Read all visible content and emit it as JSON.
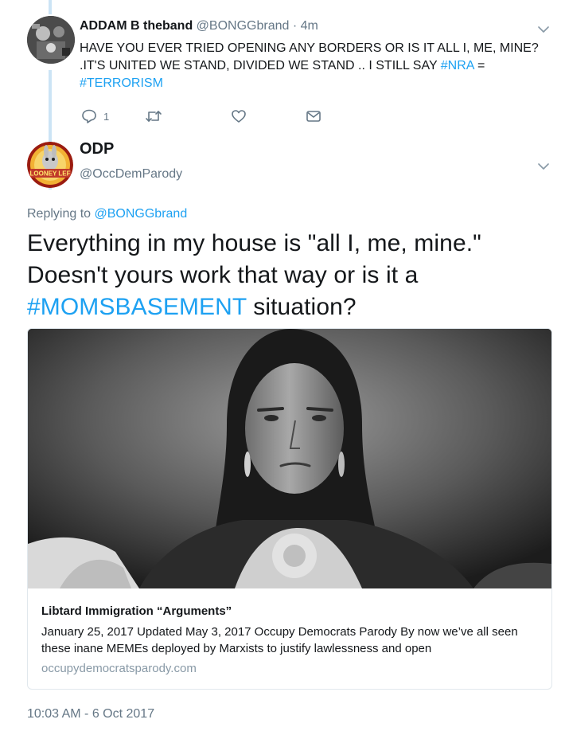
{
  "reply": {
    "author_name": "ADDAM B theband",
    "handle": "@BONGGbrand",
    "separator": "·",
    "time": "4m",
    "text_part1": "HAVE YOU EVER TRIED OPENING ANY BORDERS  OR IS IT ALL I, ME, MINE? .IT'S UNITED WE STAND, DIVIDED WE STAND  .. I STILL SAY ",
    "hashtag1": "#NRA",
    "text_part2": " = ",
    "hashtag2": "#TERRORISM",
    "reply_count": "1",
    "icons": [
      "reply-icon",
      "retweet-icon",
      "like-icon",
      "dm-icon",
      "chevron-down-icon"
    ]
  },
  "tweet": {
    "author_name": "ODP",
    "handle": "@OccDemParody",
    "avatar_text": "LOONEY LEF",
    "replying_prefix": "Replying to ",
    "replying_to": "@BONGGbrand",
    "text_part1": "Everything in my house is \"all I, me, mine.\" Doesn't yours work that way or is it a ",
    "hashtag": "#MOMSBASEMENT",
    "text_part2": " situation?",
    "timestamp": "10:03 AM - 6 Oct 2017"
  },
  "card": {
    "title": "Libtard Immigration “Arguments”",
    "description": "January 25, 2017  Updated May 3, 2017 Occupy Democrats Parody By now we’ve all seen these inane MEMEs deployed by Marxists to justify lawlessness and open",
    "domain": "occupydemocratsparody.com"
  },
  "colors": {
    "accent": "#1da1f2",
    "secondary_text": "#657786",
    "thread_line": "#cce4f5"
  }
}
